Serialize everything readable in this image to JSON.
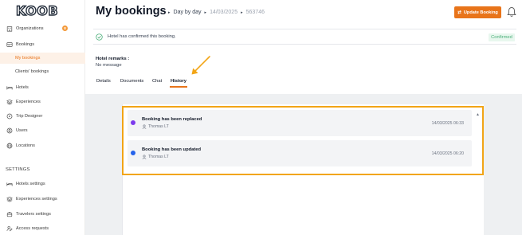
{
  "logo": "KOOB",
  "sidebar": {
    "items": [
      {
        "label": "Organizations",
        "badge": "8",
        "icon": "building-icon"
      },
      {
        "label": "Bookings",
        "icon": "bookings-icon"
      },
      {
        "label": "My bookings"
      },
      {
        "label": "Clients' bookings"
      },
      {
        "label": "Hotels",
        "icon": "bed-icon"
      },
      {
        "label": "Experiences",
        "icon": "layers-icon"
      },
      {
        "label": "Trip Designer",
        "icon": "compass-icon"
      },
      {
        "label": "Users",
        "icon": "user-circle-icon"
      },
      {
        "label": "Locations",
        "icon": "globe-icon"
      }
    ],
    "settings_heading": "SETTINGS",
    "settings_items": [
      {
        "label": "Hotels settings",
        "icon": "bed-icon"
      },
      {
        "label": "Experiences settings",
        "icon": "layers-icon"
      },
      {
        "label": "Travelers settings",
        "icon": "luggage-icon"
      },
      {
        "label": "Access requests",
        "icon": "user-edit-icon"
      }
    ]
  },
  "header": {
    "title": "My bookings",
    "breadcrumb": [
      "Day by day",
      "14/03/2025",
      "563746"
    ],
    "update_label": "Update Booking"
  },
  "confirmation": {
    "message": "Hotel has confirmed this booking.",
    "status": "Confirmed"
  },
  "remarks": {
    "label": "Hotel remarks :",
    "value": "No message"
  },
  "tabs": [
    "Details",
    "Documents",
    "Chat",
    "History"
  ],
  "active_tab": "History",
  "history": [
    {
      "title": "Booking has been replaced",
      "user": "Thomas LT",
      "date": "14/03/2025 06:33",
      "color": "#7c3aed"
    },
    {
      "title": "Booking has been updated",
      "user": "Thomas LT",
      "date": "14/03/2025 06:20",
      "color": "#2563eb"
    }
  ],
  "colors": {
    "accent": "#e8741a",
    "highlight": "#f2a516",
    "confirmed": "#4caf7a"
  }
}
